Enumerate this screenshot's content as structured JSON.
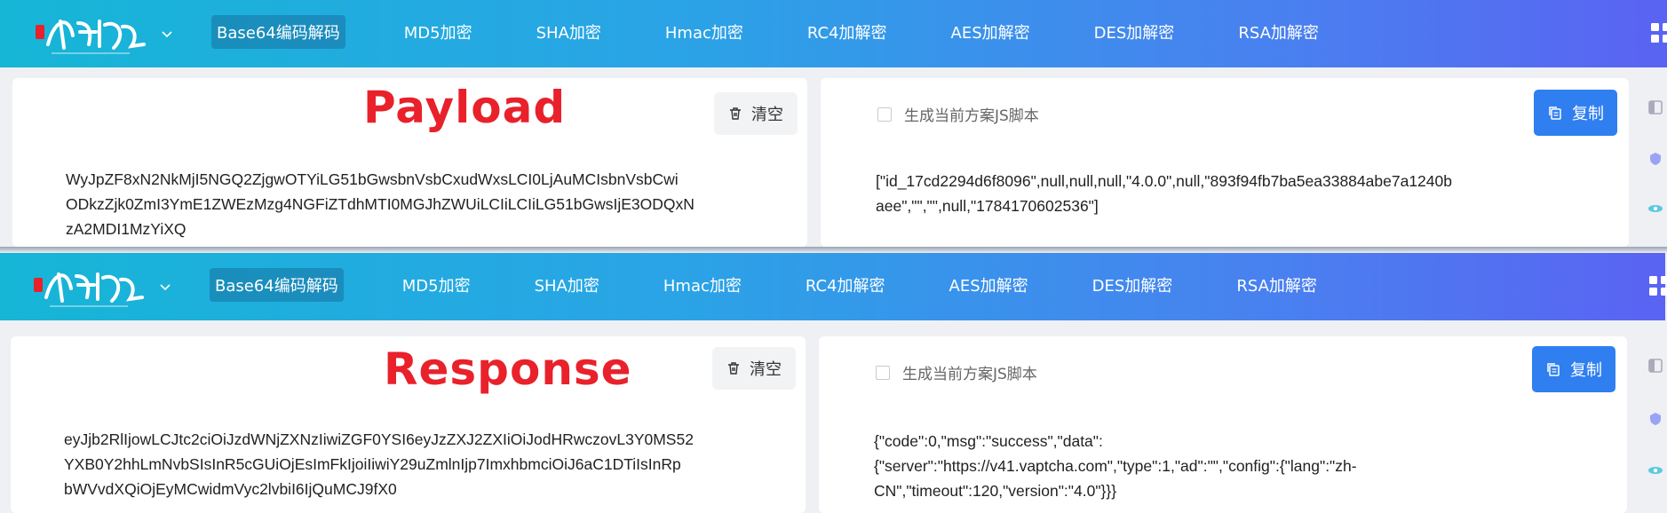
{
  "navbar": {
    "items": [
      {
        "label": "Base64编码解码",
        "active": true
      },
      {
        "label": "MD5加密",
        "active": false
      },
      {
        "label": "SHA加密",
        "active": false
      },
      {
        "label": "Hmac加密",
        "active": false
      },
      {
        "label": "RC4加解密",
        "active": false
      },
      {
        "label": "AES加解密",
        "active": false
      },
      {
        "label": "DES加解密",
        "active": false
      },
      {
        "label": "RSA加解密",
        "active": false
      }
    ]
  },
  "top": {
    "heading": "Payload",
    "clear_label": "清空",
    "checkbox_label": "生成当前方案JS脚本",
    "copy_label": "复制",
    "input_lines": [
      "WyJpZF8xN2NkMjI5NGQ2ZjgwOTYiLG51bGwsbnVsbCxudWxsLCI0LjAuMCIsbnVsbCwi",
      "ODkzZjk0ZmI3YmE1ZWEzMzg4NGFiZTdhMTI0MGJhZWUiLCIiLCIiLG51bGwsIjE3ODQxN",
      "zA2MDI1MzYiXQ"
    ],
    "output_lines": [
      "[\"id_17cd2294d6f8096\",null,null,null,\"4.0.0\",null,\"893f94fb7ba5ea33884abe7a1240b",
      "aee\",\"\",\"\",null,\"1784170602536\"]"
    ]
  },
  "bottom": {
    "heading": "Response",
    "clear_label": "清空",
    "checkbox_label": "生成当前方案JS脚本",
    "copy_label": "复制",
    "input_lines": [
      "eyJjb2RlIjowLCJtc2ciOiJzdWNjZXNzIiwiZGF0YSI6eyJzZXJ2ZXIiOiJodHRwczovL3Y0MS52",
      "YXB0Y2hhLmNvbSIsInR5cGUiOjEsImFkIjoiIiwiY29uZmlnIjp7ImxhbmciOiJ6aC1DTiIsInRp",
      "bWVvdXQiOjEyMCwidmVyc2lvbiI6IjQuMCJ9fX0"
    ],
    "output_lines": [
      "{\"code\":0,\"msg\":\"success\",\"data\":",
      "{\"server\":\"https://v41.vaptcha.com\",\"type\":1,\"ad\":\"\",\"config\":{\"lang\":\"zh-",
      "CN\",\"timeout\":120,\"version\":\"4.0\"}}}"
    ]
  },
  "colors": {
    "heading": "#e8212b",
    "copy_button": "#2f7ff1",
    "nav_start": "#16b6d6",
    "nav_end": "#5a63f2"
  },
  "icons": {
    "clear": "trash-icon",
    "copy": "copy-icon",
    "menu": "grid-icon",
    "dropdown": "chevron-down-icon"
  }
}
